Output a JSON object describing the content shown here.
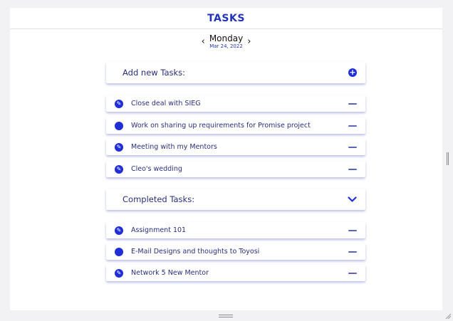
{
  "header": {
    "title": "TASKS"
  },
  "date": {
    "day": "Monday",
    "date": "Mar 24, 2022",
    "prev_icon": "chevron-left-icon",
    "next_icon": "chevron-right-icon"
  },
  "add_section": {
    "label": "Add new Tasks:",
    "icon": "plus-circle-icon"
  },
  "tasks": [
    {
      "label": "Close deal with SIEG",
      "status": "checked"
    },
    {
      "label": "Work on sharing up requirements for Promise project",
      "status": "dot"
    },
    {
      "label": "Meeting with my Mentors",
      "status": "checked"
    },
    {
      "label": "Cleo's wedding",
      "status": "checked"
    }
  ],
  "completed_section": {
    "label": "Completed Tasks:",
    "icon": "chevron-down-icon"
  },
  "completed": [
    {
      "label": "Assignment 101",
      "status": "checked"
    },
    {
      "label": "E-Mail Designs and thoughts to Toyosi",
      "status": "dot"
    },
    {
      "label": "Network 5 New Mentor",
      "status": "checked"
    }
  ],
  "colors": {
    "accent": "#1f2ed6",
    "title": "#2233b8",
    "text": "#2a2f7a"
  }
}
